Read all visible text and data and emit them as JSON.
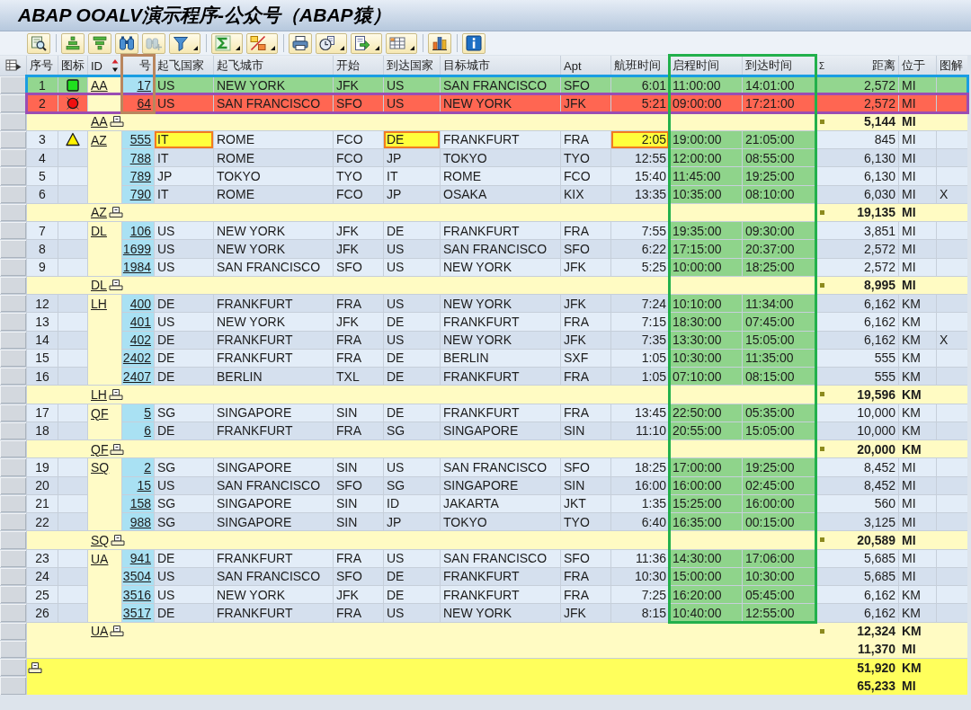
{
  "window": {
    "title": "ABAP OOALV演示程序-公众号（ABAP猿）"
  },
  "toolbar": {
    "groups": [
      [
        {
          "dropdown": false,
          "disabled": false
        }
      ],
      [
        {
          "dropdown": false,
          "disabled": false
        },
        {
          "dropdown": false,
          "disabled": false
        },
        {
          "dropdown": false,
          "disabled": false
        },
        {
          "dropdown": false,
          "disabled": true
        },
        {
          "dropdown": true,
          "disabled": false
        }
      ],
      [
        {
          "dropdown": true,
          "disabled": false
        },
        {
          "dropdown": true,
          "disabled": false
        }
      ],
      [
        {
          "dropdown": false,
          "disabled": false
        },
        {
          "dropdown": true,
          "disabled": false
        },
        {
          "dropdown": true,
          "disabled": false
        },
        {
          "dropdown": true,
          "disabled": false
        }
      ],
      [
        {
          "dropdown": false,
          "disabled": false
        }
      ],
      [
        {
          "dropdown": false,
          "disabled": false
        }
      ]
    ]
  },
  "table": {
    "columns": [
      {
        "label": "序号",
        "sorted": false
      },
      {
        "label": "图标",
        "sorted": false
      },
      {
        "label": "ID",
        "sorted": true
      },
      {
        "label": "号",
        "sorted": false,
        "frame": {
          "color": "#b9865e",
          "first_group_only": true
        }
      },
      {
        "label": "起飞国家",
        "sorted": false
      },
      {
        "label": "起飞城市",
        "sorted": false
      },
      {
        "label": "开始",
        "sorted": false
      },
      {
        "label": "到达国家",
        "sorted": false
      },
      {
        "label": "目标城市",
        "sorted": false
      },
      {
        "label": "Apt",
        "sorted": false
      },
      {
        "label": "航班时间",
        "sorted": false
      },
      {
        "label": "启程时间",
        "sorted": false,
        "frame": {
          "color": "#22b04c",
          "first_group_only": false
        }
      },
      {
        "label": "到达时间",
        "sorted": false,
        "frame": {
          "color": "#22b04c",
          "first_group_only": false
        }
      },
      {
        "label": "距离",
        "sorted": false,
        "sum_sign": "Σ"
      },
      {
        "label": "位于",
        "sorted": false
      },
      {
        "label": "图解",
        "sorted": false
      }
    ],
    "groups": [
      {
        "id": "AA",
        "rows": [
          {
            "seq": "1",
            "status_icon": {
              "kind": "square"
            },
            "no": "17",
            "from_country": "US",
            "from_city": "NEW YORK",
            "from_apt": "JFK",
            "to_country": "US",
            "to_city": "SAN FRANCISCO",
            "to_apt": "SFO",
            "duration": "6:01",
            "depart": "11:00:00",
            "arrive": "14:01:00",
            "distance": "2,572",
            "unit": "MI",
            "color": "#93d68f",
            "color_over_key": false,
            "outline": {
              "color": "#1a9de2"
            }
          },
          {
            "seq": "2",
            "status_icon": {
              "kind": "circle"
            },
            "no": "64",
            "from_country": "US",
            "from_city": "SAN FRANCISCO",
            "from_apt": "SFO",
            "to_country": "US",
            "to_city": "NEW YORK",
            "to_apt": "JFK",
            "duration": "5:21",
            "depart": "09:00:00",
            "arrive": "17:21:00",
            "distance": "2,572",
            "unit": "MI",
            "color": "#ff6652",
            "color_over_key": true,
            "outline": {
              "color": "#9a4db3"
            }
          }
        ],
        "subtotal": {
          "id": "AA",
          "lines": [
            {
              "distance": "5,144",
              "unit": "MI"
            }
          ]
        }
      },
      {
        "id": "AZ",
        "rows": [
          {
            "seq": "3",
            "status_icon": {
              "kind": "triangle"
            },
            "no": "555",
            "from_country": "IT",
            "from_city": "ROME",
            "from_apt": "FCO",
            "to_country": "DE",
            "to_city": "FRANKFURT",
            "to_apt": "FRA",
            "duration": "2:05",
            "depart": "19:00:00",
            "arrive": "21:05:00",
            "distance": "845",
            "unit": "MI",
            "highlight": {
              "from_country": true,
              "to_country": true,
              "duration": true
            }
          },
          {
            "seq": "4",
            "no": "788",
            "from_country": "IT",
            "from_city": "ROME",
            "from_apt": "FCO",
            "to_country": "JP",
            "to_city": "TOKYO",
            "to_apt": "TYO",
            "duration": "12:55",
            "depart": "12:00:00",
            "arrive": "08:55:00",
            "distance": "6,130",
            "unit": "MI"
          },
          {
            "seq": "5",
            "no": "789",
            "from_country": "JP",
            "from_city": "TOKYO",
            "from_apt": "TYO",
            "to_country": "IT",
            "to_city": "ROME",
            "to_apt": "FCO",
            "duration": "15:40",
            "depart": "11:45:00",
            "arrive": "19:25:00",
            "distance": "6,130",
            "unit": "MI"
          },
          {
            "seq": "6",
            "no": "790",
            "from_country": "IT",
            "from_city": "ROME",
            "from_apt": "FCO",
            "to_country": "JP",
            "to_city": "OSAKA",
            "to_apt": "KIX",
            "duration": "13:35",
            "depart": "10:35:00",
            "arrive": "08:10:00",
            "distance": "6,030",
            "unit": "MI",
            "legend": "X"
          }
        ],
        "subtotal": {
          "id": "AZ",
          "lines": [
            {
              "distance": "19,135",
              "unit": "MI"
            }
          ]
        }
      },
      {
        "id": "DL",
        "rows": [
          {
            "seq": "7",
            "no": "106",
            "from_country": "US",
            "from_city": "NEW YORK",
            "from_apt": "JFK",
            "to_country": "DE",
            "to_city": "FRANKFURT",
            "to_apt": "FRA",
            "duration": "7:55",
            "depart": "19:35:00",
            "arrive": "09:30:00",
            "distance": "3,851",
            "unit": "MI"
          },
          {
            "seq": "8",
            "no": "1699",
            "from_country": "US",
            "from_city": "NEW YORK",
            "from_apt": "JFK",
            "to_country": "US",
            "to_city": "SAN FRANCISCO",
            "to_apt": "SFO",
            "duration": "6:22",
            "depart": "17:15:00",
            "arrive": "20:37:00",
            "distance": "2,572",
            "unit": "MI"
          },
          {
            "seq": "9",
            "no": "1984",
            "from_country": "US",
            "from_city": "SAN FRANCISCO",
            "from_apt": "SFO",
            "to_country": "US",
            "to_city": "NEW YORK",
            "to_apt": "JFK",
            "duration": "5:25",
            "depart": "10:00:00",
            "arrive": "18:25:00",
            "distance": "2,572",
            "unit": "MI"
          }
        ],
        "subtotal": {
          "id": "DL",
          "lines": [
            {
              "distance": "8,995",
              "unit": "MI"
            }
          ]
        }
      },
      {
        "id": "LH",
        "rows": [
          {
            "seq": "12",
            "no": "400",
            "from_country": "DE",
            "from_city": "FRANKFURT",
            "from_apt": "FRA",
            "to_country": "US",
            "to_city": "NEW YORK",
            "to_apt": "JFK",
            "duration": "7:24",
            "depart": "10:10:00",
            "arrive": "11:34:00",
            "distance": "6,162",
            "unit": "KM"
          },
          {
            "seq": "13",
            "no": "401",
            "from_country": "US",
            "from_city": "NEW YORK",
            "from_apt": "JFK",
            "to_country": "DE",
            "to_city": "FRANKFURT",
            "to_apt": "FRA",
            "duration": "7:15",
            "depart": "18:30:00",
            "arrive": "07:45:00",
            "distance": "6,162",
            "unit": "KM"
          },
          {
            "seq": "14",
            "no": "402",
            "from_country": "DE",
            "from_city": "FRANKFURT",
            "from_apt": "FRA",
            "to_country": "US",
            "to_city": "NEW YORK",
            "to_apt": "JFK",
            "duration": "7:35",
            "depart": "13:30:00",
            "arrive": "15:05:00",
            "distance": "6,162",
            "unit": "KM",
            "legend": "X"
          },
          {
            "seq": "15",
            "no": "2402",
            "from_country": "DE",
            "from_city": "FRANKFURT",
            "from_apt": "FRA",
            "to_country": "DE",
            "to_city": "BERLIN",
            "to_apt": "SXF",
            "duration": "1:05",
            "depart": "10:30:00",
            "arrive": "11:35:00",
            "distance": "555",
            "unit": "KM"
          },
          {
            "seq": "16",
            "no": "2407",
            "from_country": "DE",
            "from_city": "BERLIN",
            "from_apt": "TXL",
            "to_country": "DE",
            "to_city": "FRANKFURT",
            "to_apt": "FRA",
            "duration": "1:05",
            "depart": "07:10:00",
            "arrive": "08:15:00",
            "distance": "555",
            "unit": "KM"
          }
        ],
        "subtotal": {
          "id": "LH",
          "lines": [
            {
              "distance": "19,596",
              "unit": "KM"
            }
          ]
        }
      },
      {
        "id": "QF",
        "rows": [
          {
            "seq": "17",
            "no": "5",
            "from_country": "SG",
            "from_city": "SINGAPORE",
            "from_apt": "SIN",
            "to_country": "DE",
            "to_city": "FRANKFURT",
            "to_apt": "FRA",
            "duration": "13:45",
            "depart": "22:50:00",
            "arrive": "05:35:00",
            "distance": "10,000",
            "unit": "KM"
          },
          {
            "seq": "18",
            "no": "6",
            "from_country": "DE",
            "from_city": "FRANKFURT",
            "from_apt": "FRA",
            "to_country": "SG",
            "to_city": "SINGAPORE",
            "to_apt": "SIN",
            "duration": "11:10",
            "depart": "20:55:00",
            "arrive": "15:05:00",
            "distance": "10,000",
            "unit": "KM"
          }
        ],
        "subtotal": {
          "id": "QF",
          "lines": [
            {
              "distance": "20,000",
              "unit": "KM"
            }
          ]
        }
      },
      {
        "id": "SQ",
        "rows": [
          {
            "seq": "19",
            "no": "2",
            "from_country": "SG",
            "from_city": "SINGAPORE",
            "from_apt": "SIN",
            "to_country": "US",
            "to_city": "SAN FRANCISCO",
            "to_apt": "SFO",
            "duration": "18:25",
            "depart": "17:00:00",
            "arrive": "19:25:00",
            "distance": "8,452",
            "unit": "MI"
          },
          {
            "seq": "20",
            "no": "15",
            "from_country": "US",
            "from_city": "SAN FRANCISCO",
            "from_apt": "SFO",
            "to_country": "SG",
            "to_city": "SINGAPORE",
            "to_apt": "SIN",
            "duration": "16:00",
            "depart": "16:00:00",
            "arrive": "02:45:00",
            "distance": "8,452",
            "unit": "MI"
          },
          {
            "seq": "21",
            "no": "158",
            "from_country": "SG",
            "from_city": "SINGAPORE",
            "from_apt": "SIN",
            "to_country": "ID",
            "to_city": "JAKARTA",
            "to_apt": "JKT",
            "duration": "1:35",
            "depart": "15:25:00",
            "arrive": "16:00:00",
            "distance": "560",
            "unit": "MI"
          },
          {
            "seq": "22",
            "no": "988",
            "from_country": "SG",
            "from_city": "SINGAPORE",
            "from_apt": "SIN",
            "to_country": "JP",
            "to_city": "TOKYO",
            "to_apt": "TYO",
            "duration": "6:40",
            "depart": "16:35:00",
            "arrive": "00:15:00",
            "distance": "3,125",
            "unit": "MI"
          }
        ],
        "subtotal": {
          "id": "SQ",
          "lines": [
            {
              "distance": "20,589",
              "unit": "MI"
            }
          ]
        }
      },
      {
        "id": "UA",
        "rows": [
          {
            "seq": "23",
            "no": "941",
            "from_country": "DE",
            "from_city": "FRANKFURT",
            "from_apt": "FRA",
            "to_country": "US",
            "to_city": "SAN FRANCISCO",
            "to_apt": "SFO",
            "duration": "11:36",
            "depart": "14:30:00",
            "arrive": "17:06:00",
            "distance": "5,685",
            "unit": "MI"
          },
          {
            "seq": "24",
            "no": "3504",
            "from_country": "US",
            "from_city": "SAN FRANCISCO",
            "from_apt": "SFO",
            "to_country": "DE",
            "to_city": "FRANKFURT",
            "to_apt": "FRA",
            "duration": "10:30",
            "depart": "15:00:00",
            "arrive": "10:30:00",
            "distance": "5,685",
            "unit": "MI"
          },
          {
            "seq": "25",
            "no": "3516",
            "from_country": "US",
            "from_city": "NEW YORK",
            "from_apt": "JFK",
            "to_country": "DE",
            "to_city": "FRANKFURT",
            "to_apt": "FRA",
            "duration": "7:25",
            "depart": "16:20:00",
            "arrive": "05:45:00",
            "distance": "6,162",
            "unit": "KM"
          },
          {
            "seq": "26",
            "no": "3517",
            "from_country": "DE",
            "from_city": "FRANKFURT",
            "from_apt": "FRA",
            "to_country": "US",
            "to_city": "NEW YORK",
            "to_apt": "JFK",
            "duration": "8:15",
            "depart": "10:40:00",
            "arrive": "12:55:00",
            "distance": "6,162",
            "unit": "KM"
          }
        ],
        "subtotal": {
          "id": "UA",
          "lines": [
            {
              "distance": "12,324",
              "unit": "KM"
            },
            {
              "distance": "11,370",
              "unit": "MI"
            }
          ]
        }
      }
    ],
    "total": {
      "lines": [
        {
          "distance": "51,920",
          "unit": "KM"
        },
        {
          "distance": "65,233",
          "unit": "MI"
        }
      ]
    }
  }
}
